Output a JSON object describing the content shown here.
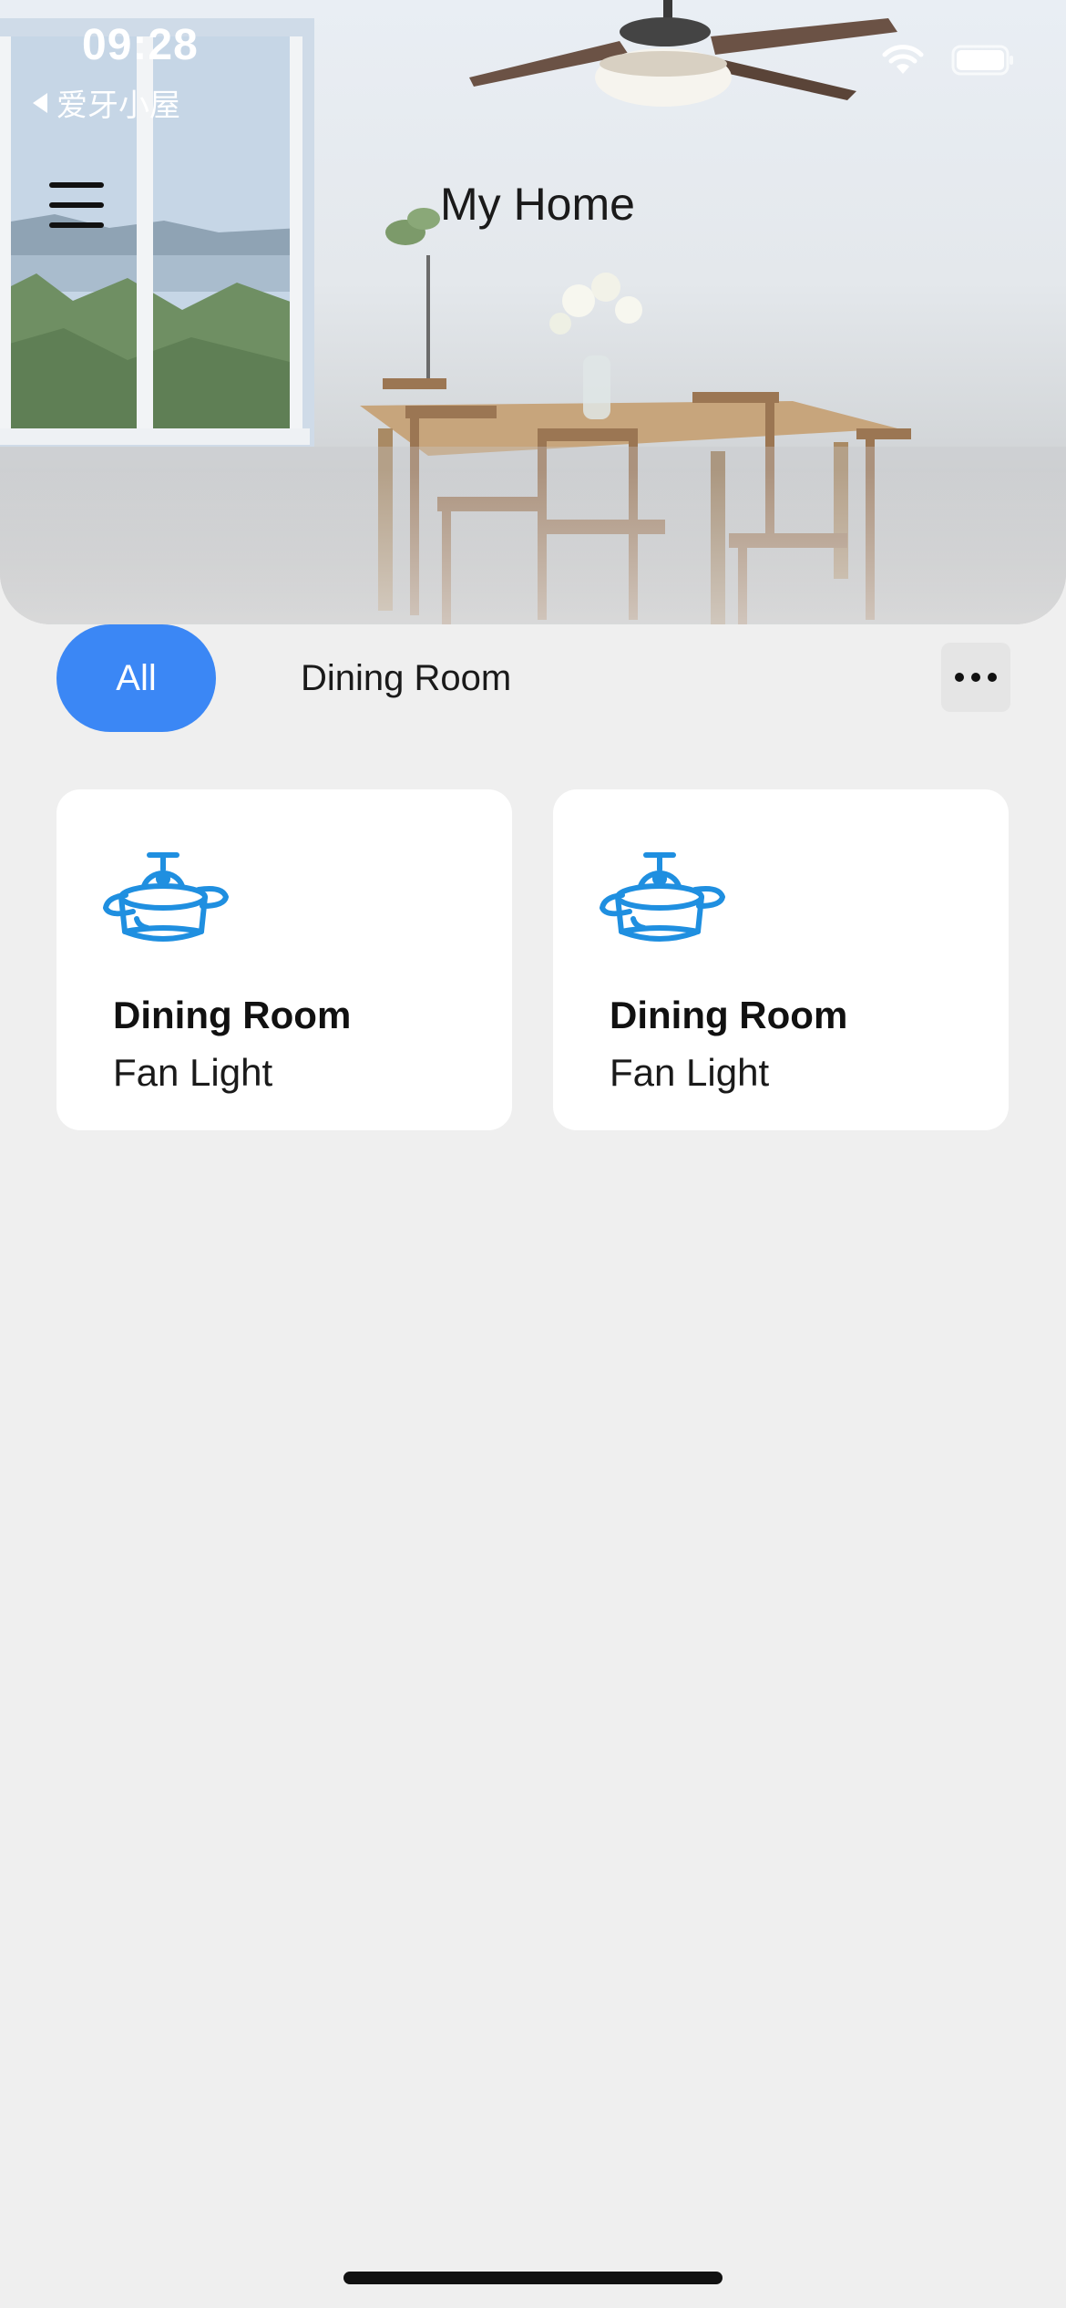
{
  "status_bar": {
    "time": "09:28",
    "back_app": "爱牙小屋",
    "icons": [
      "wifi-icon",
      "battery-icon"
    ]
  },
  "header": {
    "title": "My Home",
    "menu_icon": "hamburger-menu-icon"
  },
  "tabs": [
    {
      "label": "All",
      "active": true
    },
    {
      "label": "Dining Room",
      "active": false
    }
  ],
  "more_icon": "ellipsis-icon",
  "devices": [
    {
      "room": "Dining Room",
      "name": "Fan Light",
      "icon": "ceiling-fan-light-icon"
    },
    {
      "room": "Dining Room",
      "name": "Fan Light",
      "icon": "ceiling-fan-light-icon"
    }
  ],
  "colors": {
    "accent": "#3b87f5",
    "device_icon": "#1f8fe0",
    "background": "#efefef"
  }
}
